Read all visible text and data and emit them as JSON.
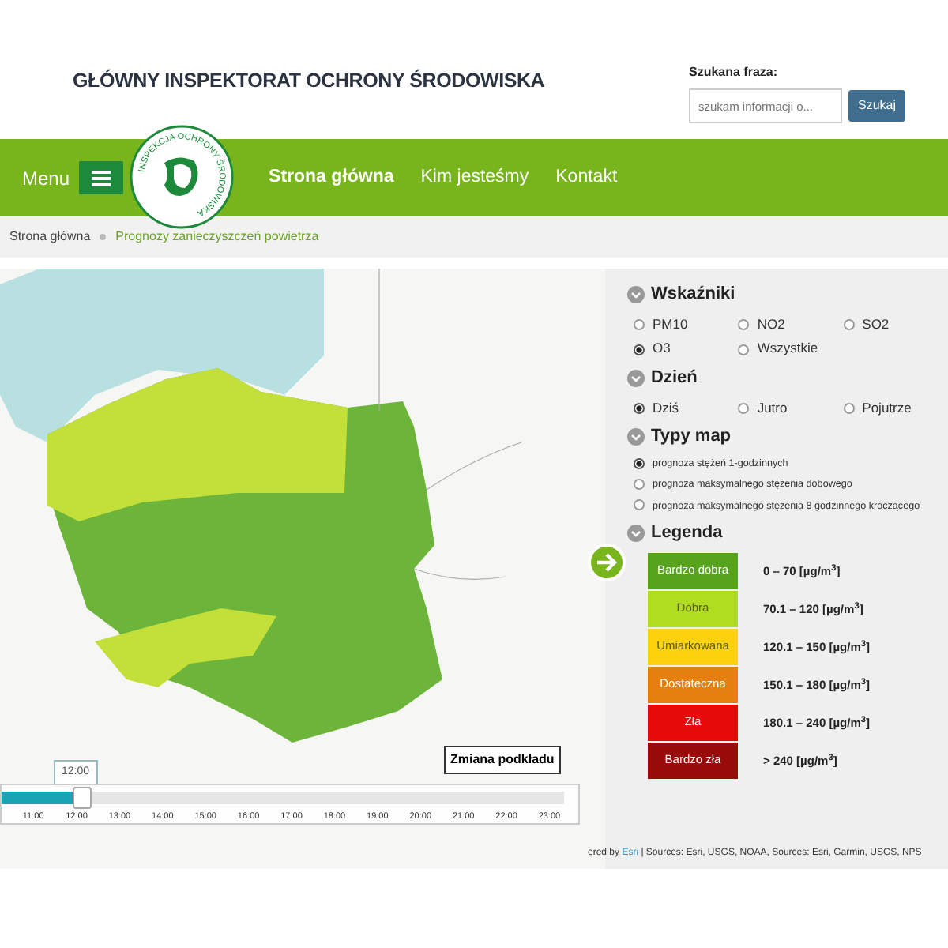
{
  "header": {
    "title": "GŁÓWNY INSPEKTORAT OCHRONY ŚRODOWISKA",
    "search_label": "Szukana fraza:",
    "search": {
      "placeholder": "szukam informacji o..."
    },
    "search_button": "Szukaj"
  },
  "logo": {
    "ring_text": "INSPEKCJA OCHRONY ŚRODOWISKA"
  },
  "nav": {
    "menu_label": "Menu",
    "items": [
      {
        "label": "Strona główna",
        "selected": true
      },
      {
        "label": "Kim jesteśmy",
        "selected": false
      },
      {
        "label": "Kontakt",
        "selected": false
      }
    ]
  },
  "breadcrumb": [
    {
      "label": "Strona główna",
      "selected": false
    },
    {
      "label": "Prognozy zanieczyszczeń powietrza",
      "selected": true
    }
  ],
  "map": {
    "basemap_button": "Zmiana podkładu",
    "time": {
      "tooltip": "12:00",
      "level": 0.13,
      "ticks": [
        "11:00",
        "12:00",
        "13:00",
        "14:00",
        "15:00",
        "16:00",
        "17:00",
        "18:00",
        "19:00",
        "20:00",
        "21:00",
        "22:00",
        "23:00"
      ]
    },
    "attribution": "ered by ",
    "attribution_link": "Esri",
    "attribution_rest": " | Sources: Esri, USGS, NOAA, Sources: Esri, Garmin, USGS, NPS"
  },
  "panel": {
    "sections": [
      {
        "title": "Wskaźniki",
        "kind": "grid",
        "options": [
          {
            "label": "PM10",
            "selected": false
          },
          {
            "label": "NO2",
            "selected": false
          },
          {
            "label": "SO2",
            "selected": false
          },
          {
            "label": "O3",
            "selected": true
          },
          {
            "label": "Wszystkie",
            "selected": false
          }
        ]
      },
      {
        "title": "Dzień",
        "kind": "grid",
        "options": [
          {
            "label": "Dziś",
            "selected": true
          },
          {
            "label": "Jutro",
            "selected": false
          },
          {
            "label": "Pojutrze",
            "selected": false
          }
        ]
      },
      {
        "title": "Typy map",
        "kind": "list",
        "options": [
          {
            "label": "prognoza stężeń 1-godzinnych",
            "selected": true
          },
          {
            "label": "prognoza maksymalnego stężenia dobowego",
            "selected": false
          },
          {
            "label": "prognoza maksymalnego stężenia 8 godzinnego kroczącego",
            "selected": false
          }
        ]
      }
    ],
    "legend": {
      "title": "Legenda",
      "items": [
        {
          "label": "Bardzo dobra",
          "range": "0 – 70 [µg/m$^{3}$]",
          "color": "#57a31d"
        },
        {
          "label": "Dobra",
          "range": "70.1 – 120 [µg/m$^{3}$]",
          "color": "#b0dd20"
        },
        {
          "label": "Umiarkowana",
          "range": "120.1 – 150 [µg/m$^{3}$]",
          "color": "#fcd20f"
        },
        {
          "label": "Dostateczna",
          "range": "150.1 – 180 [µg/m$^{3}$]",
          "color": "#e5800e"
        },
        {
          "label": "Zła",
          "range": "180.1 – 240 [µg/m$^{3}$]",
          "color": "#e50b0b"
        },
        {
          "label": "Bardzo zła",
          "range": "> 240 [µg/m$^{3}$]",
          "color": "#990a0a"
        }
      ]
    }
  }
}
